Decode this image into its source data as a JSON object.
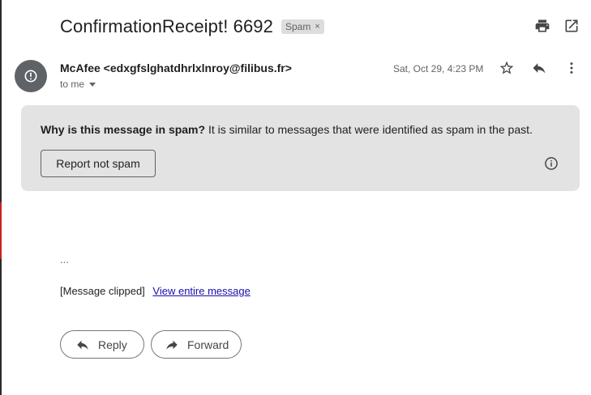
{
  "email": {
    "subject": "ConfirmationReceipt! 6692",
    "label_chip": "Spam",
    "label_remove": "×",
    "sender": "McAfee <edxgfslghatdhrlxlnroy@filibus.fr>",
    "recipient": "to me",
    "date": "Sat, Oct 29, 4:23 PM"
  },
  "spam_notice": {
    "question": "Why is this message in spam?",
    "reason": " It is similar to messages that were identified as spam in the past.",
    "report_button": "Report not spam"
  },
  "body": {
    "ellipsis": "...",
    "clipped_text": "[Message clipped]",
    "view_link": "View entire message"
  },
  "actions": {
    "reply": "Reply",
    "forward": "Forward"
  },
  "icons": {
    "print": "print-icon",
    "open_new_window": "open-in-new-window-icon",
    "avatar": "alert-circle-icon",
    "star": "star-icon",
    "reply": "reply-icon",
    "more": "more-vert-icon",
    "info": "info-icon",
    "forward": "forward-icon"
  },
  "colors": {
    "spam_box": "#e3e3e3",
    "avatar": "#5f6368",
    "link": "#1a0dab"
  }
}
